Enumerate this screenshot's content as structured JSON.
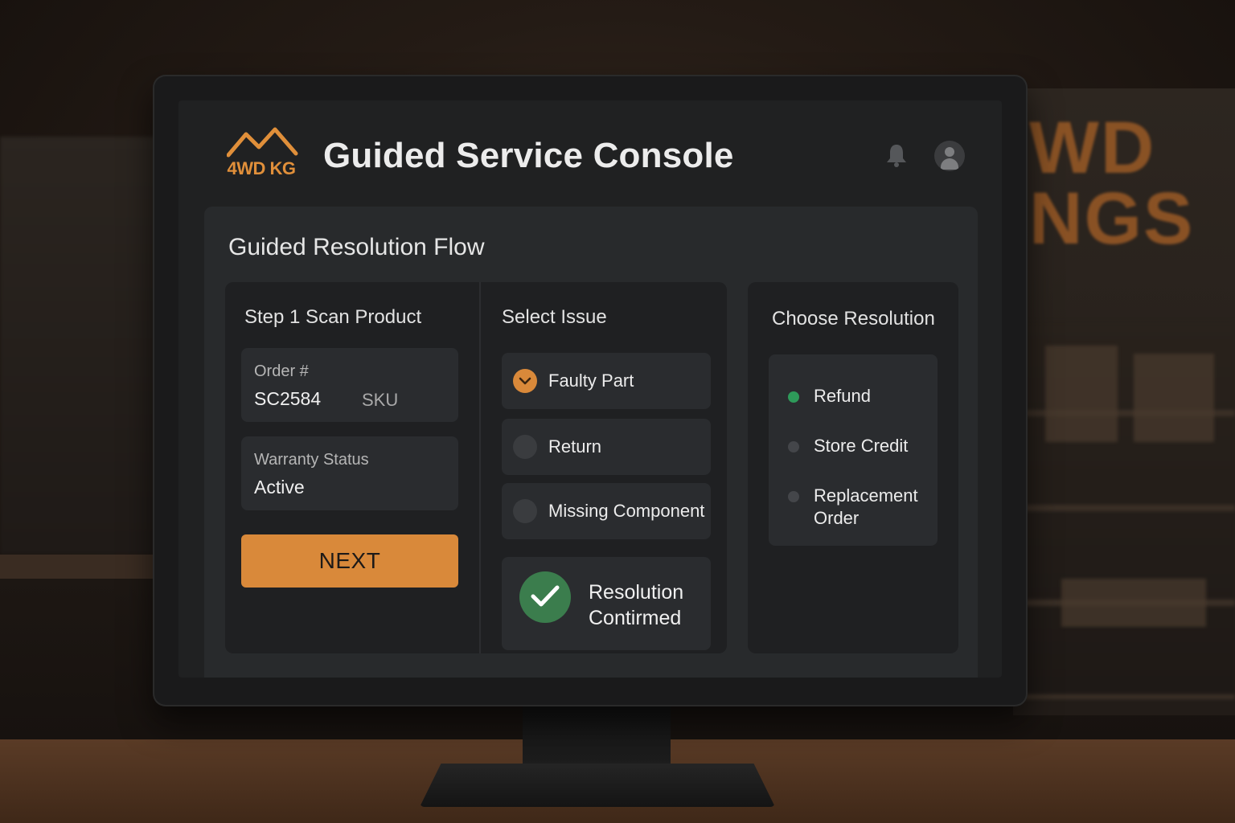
{
  "brand": {
    "logo_text": "4WD KG",
    "background_sign": [
      "WD",
      "NGS"
    ],
    "accent_color": "#d9893a"
  },
  "header": {
    "title": "Guided Service Console"
  },
  "flow": {
    "title": "Guided Resolution Flow",
    "step1": {
      "title": "Step 1  Scan Product",
      "order_label": "Order #",
      "order_value": "SC2584",
      "order_extra": "SKU",
      "warranty_label": "Warranty Status",
      "warranty_value": "Active",
      "next_label": "NEXT"
    },
    "issue": {
      "title": "Select Issue",
      "options": [
        {
          "label": "Faulty Part",
          "selected": true
        },
        {
          "label": "Return",
          "selected": false
        },
        {
          "label": "Missing Component",
          "selected": false
        }
      ],
      "confirmation": "Resolution Contirmed",
      "confirmation_color": "#3b7d4d"
    },
    "resolution": {
      "title": "Choose Resolution",
      "options": [
        {
          "label": "Refund",
          "selected": true
        },
        {
          "label": "Store Credit",
          "selected": false
        },
        {
          "label": "Replacement Order",
          "selected": false
        }
      ],
      "selected_color": "#2e9a5a"
    }
  },
  "icons": {
    "bell": "bell-icon",
    "user": "user-avatar-icon",
    "check": "check-icon",
    "logo": "mountain-logo-icon"
  }
}
